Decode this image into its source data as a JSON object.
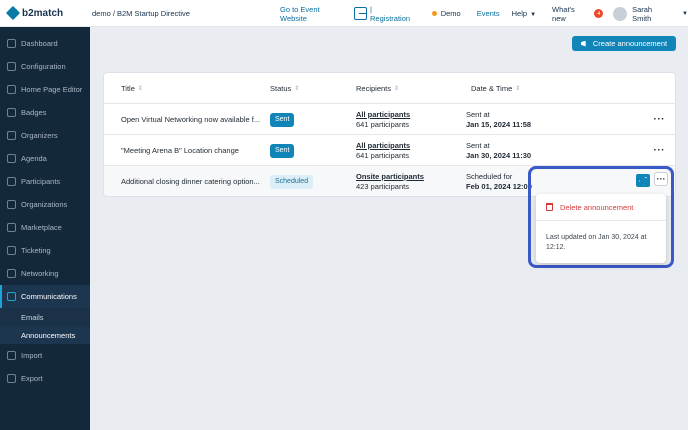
{
  "topbar": {
    "logo": "b2match",
    "breadcrumb": "demo / B2M Startup Directive",
    "goto_event": "Go to Event Website",
    "registration": "| Registration",
    "demo": "Demo",
    "events": "Events",
    "help": "Help",
    "whats_new": "What's new",
    "whats_new_count": "4",
    "user": "Sarah Smith"
  },
  "sidebar": {
    "items": [
      {
        "label": "Dashboard",
        "icon": "dashboard-icon"
      },
      {
        "label": "Configuration",
        "icon": "configuration-icon"
      },
      {
        "label": "Home Page Editor",
        "icon": "home-page-editor-icon"
      },
      {
        "label": "Badges",
        "icon": "badges-icon"
      },
      {
        "label": "Organizers",
        "icon": "organizers-icon"
      },
      {
        "label": "Agenda",
        "icon": "agenda-icon"
      },
      {
        "label": "Participants",
        "icon": "participants-icon"
      },
      {
        "label": "Organizations",
        "icon": "organizations-icon"
      },
      {
        "label": "Marketplace",
        "icon": "marketplace-icon"
      },
      {
        "label": "Ticketing",
        "icon": "ticketing-icon"
      },
      {
        "label": "Networking",
        "icon": "networking-icon"
      },
      {
        "label": "Communications",
        "icon": "communications-icon"
      }
    ],
    "sub_items": [
      {
        "label": "Emails"
      },
      {
        "label": "Announcements"
      }
    ],
    "bottom_items": [
      {
        "label": "Import",
        "icon": "import-icon"
      },
      {
        "label": "Export",
        "icon": "export-icon"
      }
    ]
  },
  "main": {
    "create_button": "Create announcement",
    "columns": {
      "title": "Title",
      "status": "Status",
      "recipients": "Recipients",
      "datetime": "Date & Time"
    },
    "rows": [
      {
        "title": "Open Virtual Networking now available f...",
        "status": "Sent",
        "recipients": "All participants",
        "count": "641 participants",
        "date_label": "Sent at",
        "date": "Jan 15, 2024 11:58"
      },
      {
        "title": "\"Meeting Arena B\" Location change",
        "status": "Sent",
        "recipients": "All participants",
        "count": "641 participants",
        "date_label": "Sent at",
        "date": "Jan 30, 2024 11:30"
      },
      {
        "title": "Additional closing dinner catering option...",
        "status": "Scheduled",
        "recipients": "Onsite participants",
        "count": "423 participants",
        "date_label": "Scheduled for",
        "date": "Feb 01, 2024 12:00"
      }
    ],
    "menu": {
      "delete": "Delete announcement",
      "updated": "Last updated on Jan 30, 2024 at 12:12."
    }
  },
  "colors": {
    "accent": "#1285b8",
    "sidebar": "#14283c",
    "danger": "#d23b3b",
    "highlight": "#3a59c7"
  }
}
